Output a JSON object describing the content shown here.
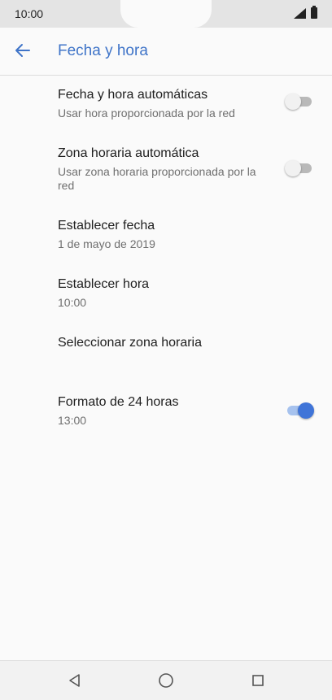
{
  "status_bar": {
    "time": "10:00"
  },
  "header": {
    "title": "Fecha y hora",
    "back_icon": "arrow-left-icon"
  },
  "settings": [
    {
      "title": "Fecha y hora automáticas",
      "subtitle": "Usar hora proporcionada por la red",
      "toggle": "off"
    },
    {
      "title": "Zona horaria automática",
      "subtitle": "Usar zona horaria proporcionada por la red",
      "toggle": "off"
    },
    {
      "title": "Establecer fecha",
      "subtitle": "1 de mayo de 2019"
    },
    {
      "title": "Establecer hora",
      "subtitle": "10:00"
    },
    {
      "title": "Seleccionar zona horaria"
    },
    {
      "title": "Formato de 24 horas",
      "subtitle": "13:00",
      "toggle": "on"
    }
  ],
  "colors": {
    "accent": "#3f74d8",
    "title_blue": "#3f74c8"
  },
  "nav": {
    "icons": [
      "back-triangle-icon",
      "home-circle-icon",
      "recents-square-icon"
    ]
  }
}
